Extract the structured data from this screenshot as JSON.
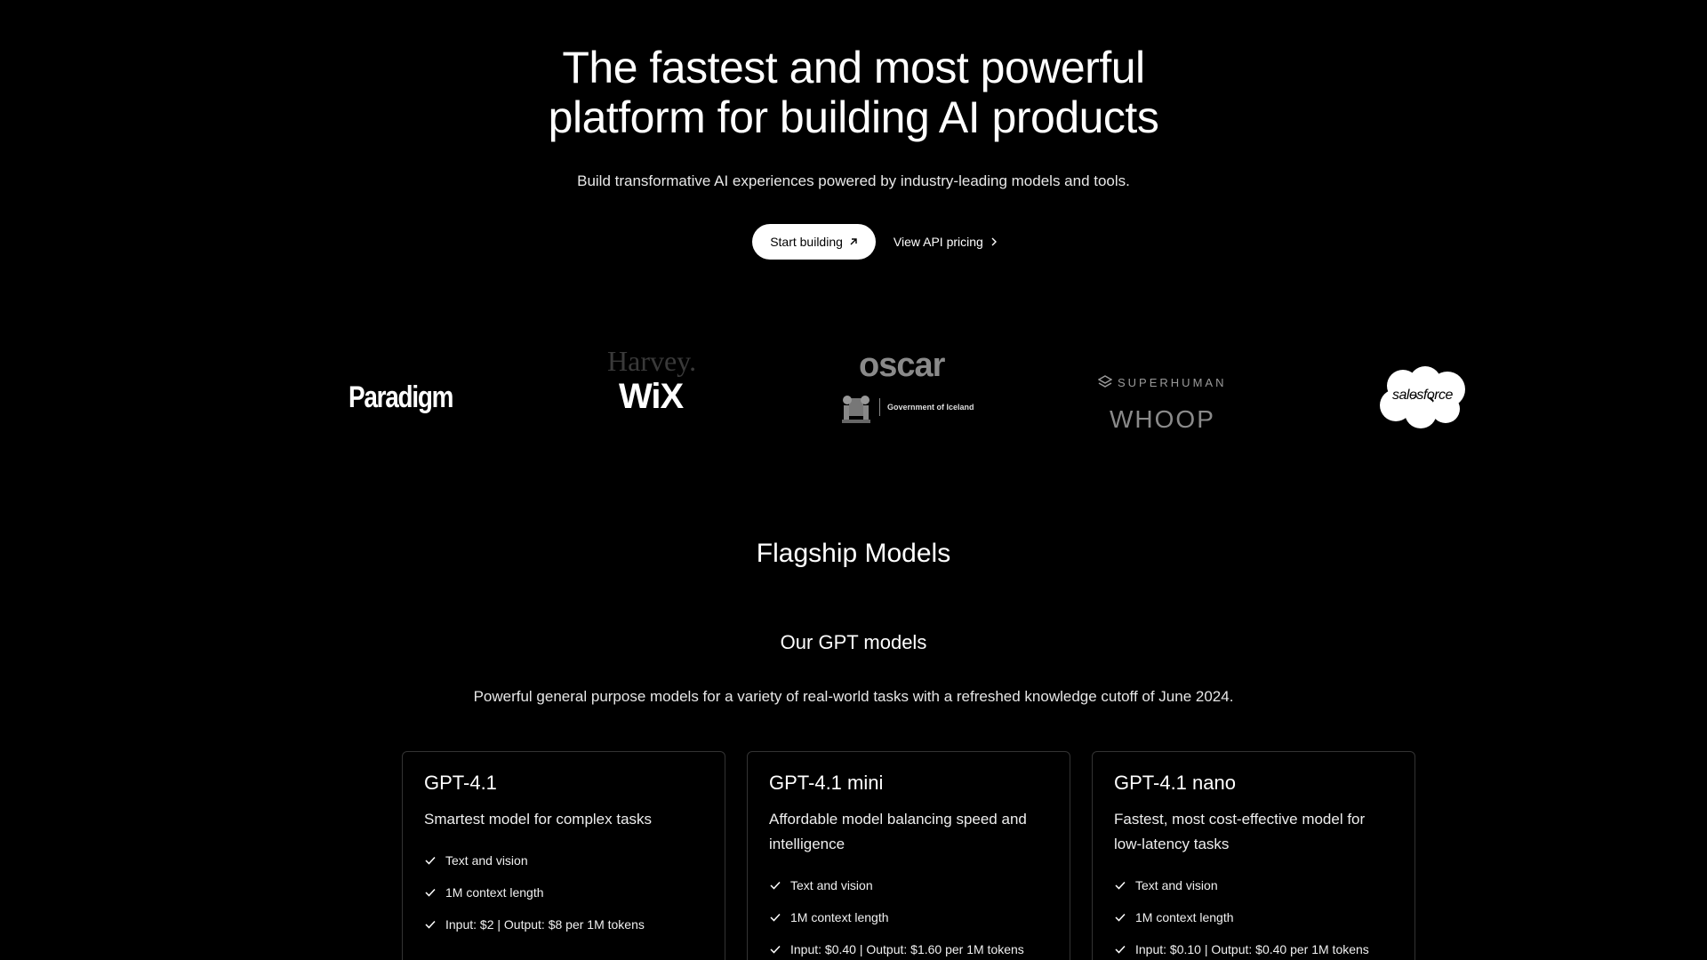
{
  "hero": {
    "title_line1": "The fastest and most powerful",
    "title_line2": "platform for building AI products",
    "subtitle": "Build transformative AI experiences powered by industry-leading models and tools.",
    "primary_button": "Start building",
    "secondary_button": "View API pricing"
  },
  "logos": {
    "paradigm": "Paradigm",
    "harvey": "Harvey.",
    "wix": "WiX",
    "oscar": "oscar",
    "iceland": "Government of Iceland",
    "superhuman": "SUPERHUMAN",
    "whoop": "WHOOP",
    "salesforce": "salesforce"
  },
  "flagship": {
    "title": "Flagship Models",
    "subtitle": "Our GPT models",
    "description": "Powerful general purpose models for a variety of real-world tasks with a refreshed knowledge cutoff of June 2024.",
    "cards": [
      {
        "name": "GPT-4.1",
        "description": "Smartest model for complex tasks",
        "features": [
          "Text and vision",
          "1M context length",
          "Input: $2 | Output: $8 per 1M tokens"
        ]
      },
      {
        "name": "GPT-4.1 mini",
        "description": "Affordable model balancing speed and intelligence",
        "features": [
          "Text and vision",
          "1M context length",
          "Input: $0.40 | Output: $1.60 per 1M tokens"
        ]
      },
      {
        "name": "GPT-4.1 nano",
        "description": "Fastest, most cost-effective model for low-latency tasks",
        "features": [
          "Text and vision",
          "1M context length",
          "Input: $0.10 | Output: $0.40 per 1M tokens"
        ]
      }
    ]
  },
  "icons": {
    "primary_button_icon": "arrow-up-right-icon",
    "secondary_button_icon": "chevron-right-icon",
    "feature_icon": "check-icon"
  }
}
